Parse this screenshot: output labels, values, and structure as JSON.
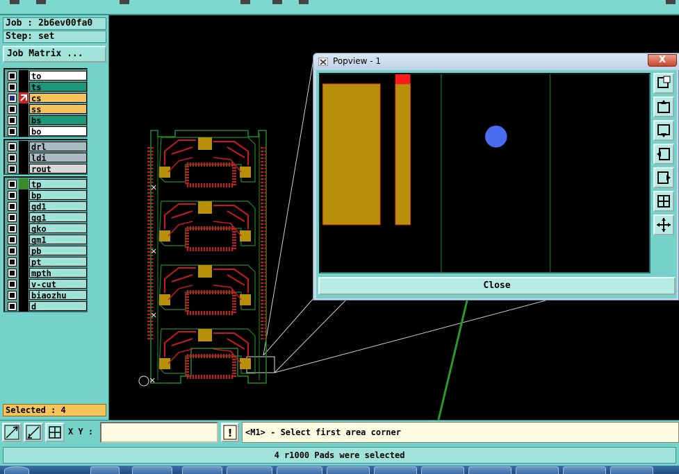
{
  "job": {
    "job_label": "Job : 2b6ev00fa0",
    "step_label": "Step: set",
    "matrix_button": "Job Matrix ..."
  },
  "layer_groups": [
    {
      "layers": [
        {
          "name": "to",
          "color": "#ffffff",
          "swatch": "#000000",
          "selected": false
        },
        {
          "name": "ts",
          "color": "#1a9a7a",
          "swatch": "#000000",
          "selected": false
        },
        {
          "name": "cs",
          "color": "#f7c45a",
          "swatch": "#cc2222",
          "selected": true
        },
        {
          "name": "ss",
          "color": "#f7c45a",
          "swatch": "#000000",
          "selected": false
        },
        {
          "name": "bs",
          "color": "#1a9a7a",
          "swatch": "#000000",
          "selected": false
        },
        {
          "name": "bo",
          "color": "#ffffff",
          "swatch": "#000000",
          "selected": false
        }
      ]
    },
    {
      "layers": [
        {
          "name": "drl",
          "color": "#a9bcc4",
          "swatch": "#000000",
          "selected": false
        },
        {
          "name": "ldi",
          "color": "#a9bcc4",
          "swatch": "#000000",
          "selected": false
        },
        {
          "name": "rout",
          "color": "#d8d8d8",
          "swatch": "#000000",
          "selected": false
        }
      ]
    },
    {
      "layers": [
        {
          "name": "tp",
          "color": "#9fe3db",
          "swatch": "#3a8a2a",
          "selected": false
        },
        {
          "name": "bp",
          "color": "#9fe3db",
          "swatch": "#000000",
          "selected": false
        },
        {
          "name": "gd1",
          "color": "#9fe3db",
          "swatch": "#000000",
          "selected": false
        },
        {
          "name": "gg1",
          "color": "#9fe3db",
          "swatch": "#000000",
          "selected": false
        },
        {
          "name": "gko",
          "color": "#9fe3db",
          "swatch": "#000000",
          "selected": false
        },
        {
          "name": "gm1",
          "color": "#9fe3db",
          "swatch": "#000000",
          "selected": false
        },
        {
          "name": "pb",
          "color": "#9fe3db",
          "swatch": "#000000",
          "selected": false
        },
        {
          "name": "pt",
          "color": "#9fe3db",
          "swatch": "#000000",
          "selected": false
        },
        {
          "name": "mpth",
          "color": "#9fe3db",
          "swatch": "#000000",
          "selected": false
        },
        {
          "name": "v-cut",
          "color": "#9fe3db",
          "swatch": "#000000",
          "selected": false
        },
        {
          "name": "biaozhu",
          "color": "#9fe3db",
          "swatch": "#000000",
          "selected": false
        },
        {
          "name": "d",
          "color": "#9fe3db",
          "swatch": "#000000",
          "selected": false
        }
      ]
    }
  ],
  "selected_label": "Selected : 4",
  "bottom": {
    "xy_label": "X Y :",
    "xy_value": "",
    "prompt": "<M1> - Select first area corner",
    "alert_glyph": "!"
  },
  "status": "4 r1000 Pads were selected",
  "popview": {
    "title": "Popview - 1",
    "close_x": "X",
    "close_button": "Close"
  },
  "icons": [
    "zoom-area-icon",
    "measure-icon",
    "snap-grid-icon",
    "alert-icon",
    "pan-up-icon",
    "pan-down-icon",
    "pan-left-icon",
    "pan-right-icon",
    "zoom-fit-icon",
    "zoom-home-icon"
  ],
  "colors": {
    "panel": "#74d2c8",
    "copper": "#b8900a",
    "trace": "#cc1a1a",
    "outline": "#1f8a2a",
    "pad_selected": "#4a6cf0",
    "arrow": "#2a9a2a"
  }
}
